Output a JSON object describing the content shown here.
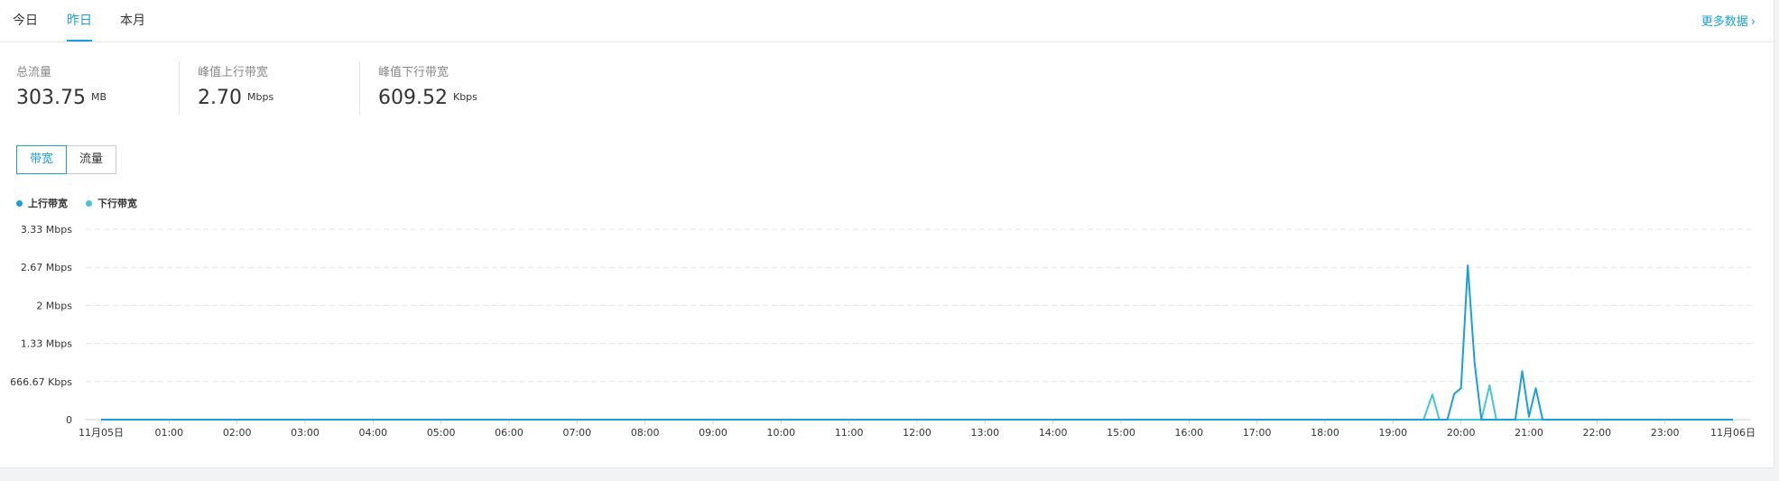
{
  "tabs": [
    {
      "label": "今日",
      "active": false
    },
    {
      "label": "昨日",
      "active": true
    },
    {
      "label": "本月",
      "active": false
    }
  ],
  "more_link": "更多数据",
  "stats": [
    {
      "label": "总流量",
      "value": "303.75",
      "unit": "MB"
    },
    {
      "label": "峰值上行带宽",
      "value": "2.70",
      "unit": "Mbps"
    },
    {
      "label": "峰值下行带宽",
      "value": "609.52",
      "unit": "Kbps"
    }
  ],
  "segments": [
    {
      "label": "带宽",
      "active": true
    },
    {
      "label": "流量",
      "active": false
    }
  ],
  "colors": {
    "accent": "#1a9fd6",
    "upload": "#1a9fd6",
    "download": "#45c6d8",
    "grid": "#e3e3e3"
  },
  "chart_data": {
    "type": "line",
    "title": "",
    "legend": [
      "上行带宽",
      "下行带宽"
    ],
    "legend_position": "top-left",
    "grid": true,
    "y_tick_labels": [
      "0",
      "666.67 Kbps",
      "1.33 Mbps",
      "2 Mbps",
      "2.67 Mbps",
      "3.33 Mbps"
    ],
    "y_ticks_mbps": [
      0,
      0.66667,
      1.33333,
      2,
      2.66667,
      3.33333
    ],
    "ylim_mbps": [
      0,
      3.33333
    ],
    "x_tick_labels": [
      "11月05日",
      "01:00",
      "02:00",
      "03:00",
      "04:00",
      "05:00",
      "06:00",
      "07:00",
      "08:00",
      "09:00",
      "10:00",
      "11:00",
      "12:00",
      "13:00",
      "14:00",
      "15:00",
      "16:00",
      "17:00",
      "18:00",
      "19:00",
      "20:00",
      "21:00",
      "22:00",
      "23:00",
      "11月06日"
    ],
    "x_unit": "hour",
    "xlim": [
      0,
      24
    ],
    "series": [
      {
        "name": "上行带宽",
        "color": "#1a9fd6",
        "points": [
          [
            0,
            0
          ],
          [
            19.4,
            0
          ],
          [
            19.6,
            0
          ],
          [
            19.8,
            0
          ],
          [
            19.9,
            0.45
          ],
          [
            20.0,
            0.55
          ],
          [
            20.1,
            2.7
          ],
          [
            20.2,
            1.0
          ],
          [
            20.3,
            0
          ],
          [
            20.4,
            0
          ],
          [
            20.7,
            0
          ],
          [
            20.8,
            0
          ],
          [
            20.9,
            0.85
          ],
          [
            21.0,
            0.05
          ],
          [
            21.1,
            0.55
          ],
          [
            21.2,
            0
          ],
          [
            21.5,
            0
          ],
          [
            24,
            0
          ]
        ]
      },
      {
        "name": "下行带宽",
        "color": "#45c6d8",
        "points": [
          [
            0,
            0
          ],
          [
            19.45,
            0
          ],
          [
            19.58,
            0.44
          ],
          [
            19.68,
            0
          ],
          [
            20.3,
            0
          ],
          [
            20.42,
            0.6
          ],
          [
            20.52,
            0
          ],
          [
            24,
            0
          ]
        ]
      }
    ]
  }
}
